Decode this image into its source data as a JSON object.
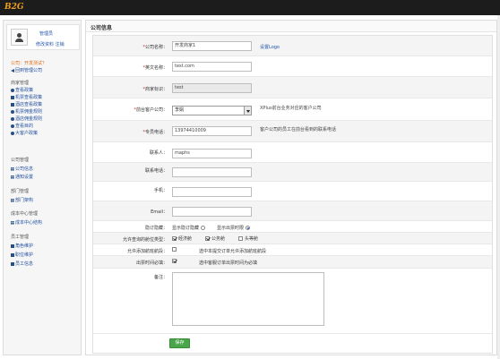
{
  "app": {
    "logo": "B2G"
  },
  "user": {
    "name": "管理员",
    "link1": "修改资料",
    "link2": "注销"
  },
  "sidebar": {
    "tip": "公司：开发测试？",
    "switch": "回到管理公司",
    "groups": [
      {
        "title": "商家管理",
        "items": [
          "查看政策",
          "机票查看政策",
          "酒店查看政策",
          "机票佣金规则",
          "酒店佣金规则",
          "查看目的",
          "大客户政策"
        ]
      },
      {
        "title": "公司管理",
        "items": [
          "公司信息",
          "通知设置"
        ]
      },
      {
        "title": "部门管理",
        "items": [
          "部门架构"
        ]
      },
      {
        "title": "成本中心管理",
        "items": [
          "成本中心结构"
        ]
      },
      {
        "title": "员工管理",
        "items": [
          "角色维护",
          "职位维护",
          "员工信息"
        ]
      }
    ]
  },
  "main": {
    "title": "公司信息"
  },
  "form": {
    "company_name": {
      "label": "公司名称：",
      "value": "开发商家1",
      "link": "设置Logo"
    },
    "en_name": {
      "label": "英文名称：",
      "value": "test.com"
    },
    "merchant_id": {
      "label": "商家标识：",
      "value": "test"
    },
    "parent": {
      "label": "前台客户公司：",
      "value": "李娟",
      "note": "XPlus前台业务对应的客户公司"
    },
    "phone": {
      "label": "专员电话：",
      "value": "13974410009",
      "note": "客户公司的员工在前台看到的联系电话"
    },
    "contact": {
      "label": "联系人：",
      "value": "maphs"
    },
    "contact_phone": {
      "label": "联系电话：",
      "value": ""
    },
    "mobile": {
      "label": "手机：",
      "value": ""
    },
    "email": {
      "label": "Email：",
      "value": ""
    },
    "display": {
      "label": "隐订隐藏：",
      "opt1": "显示隐订隐藏",
      "opt2": "显示出票时限"
    },
    "cabin": {
      "label": "允许查询的舱位类型：",
      "opt1": "经济舱",
      "opt2": "公务舱",
      "opt3": "头等舱"
    },
    "add_flight": {
      "label": "允许添加航班航段：",
      "text": "选中本提交订单允许添加航班航段"
    },
    "ticket_time": {
      "label": "出票时间必填：",
      "text": "选中客服订单出票时间为必填"
    },
    "remark": {
      "label": "备注："
    },
    "save": "保存"
  }
}
